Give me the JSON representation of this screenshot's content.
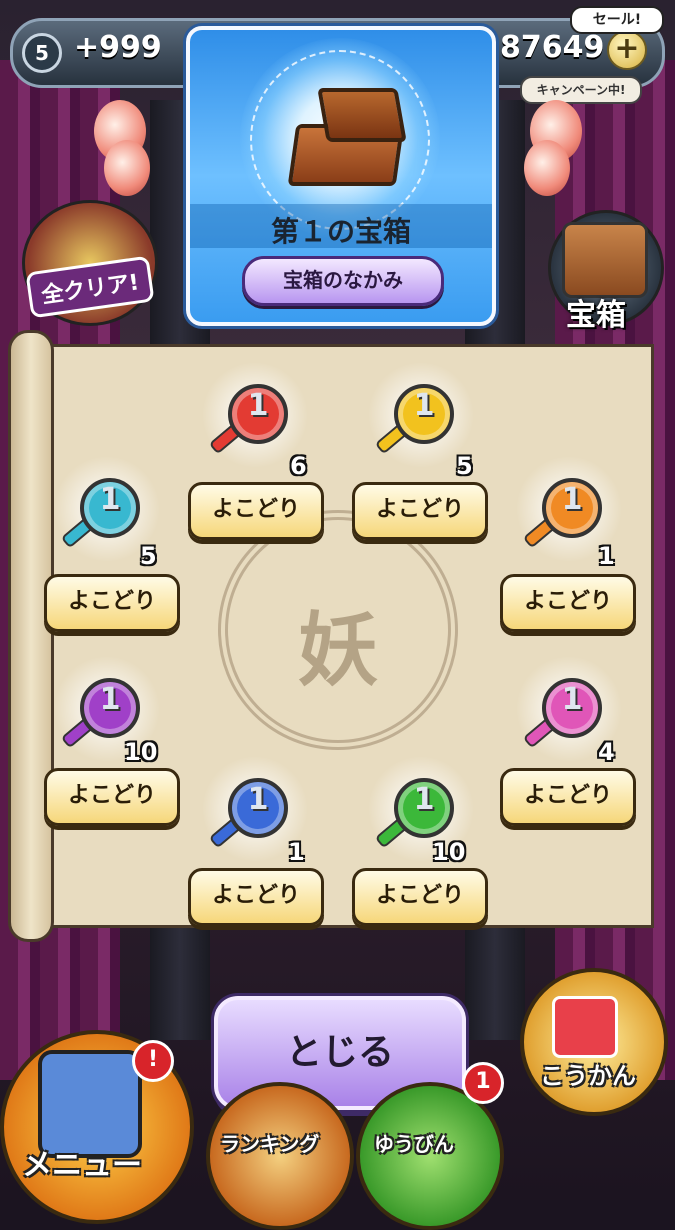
{
  "status_bar": {
    "level": "5",
    "stamina": "+999",
    "coins": "87649",
    "add_label": "+",
    "sale_label": "セール!",
    "campaign_label": "キャンペーン中!"
  },
  "side": {
    "all_clear_label": "全クリア!",
    "chest_label": "宝箱"
  },
  "card": {
    "title": "第１の宝箱",
    "contents_button": "宝箱のなかみ",
    "accent_color": "#3a9cf0"
  },
  "scroll": {
    "emblem_char": "妖"
  },
  "keys": [
    {
      "color": "#e33b33",
      "count": "6",
      "button": "よこどり"
    },
    {
      "color": "#f2c21e",
      "count": "5",
      "button": "よこどり"
    },
    {
      "color": "#38b8d0",
      "count": "5",
      "button": "よこどり"
    },
    {
      "color": "#f08a24",
      "count": "1",
      "button": "よこどり"
    },
    {
      "color": "#a040c8",
      "count": "10",
      "button": "よこどり"
    },
    {
      "color": "#e056b8",
      "count": "4",
      "button": "よこどり"
    },
    {
      "color": "#3a6ad8",
      "count": "1",
      "button": "よこどり"
    },
    {
      "color": "#3cb83a",
      "count": "10",
      "button": "よこどり"
    }
  ],
  "close_button": "とじる",
  "bottom_nav": {
    "menu": "メニュー",
    "ranking": "ランキング",
    "mail": "ゆうびん",
    "exchange": "こうかん",
    "menu_alert": "!",
    "mail_alert": "1"
  }
}
